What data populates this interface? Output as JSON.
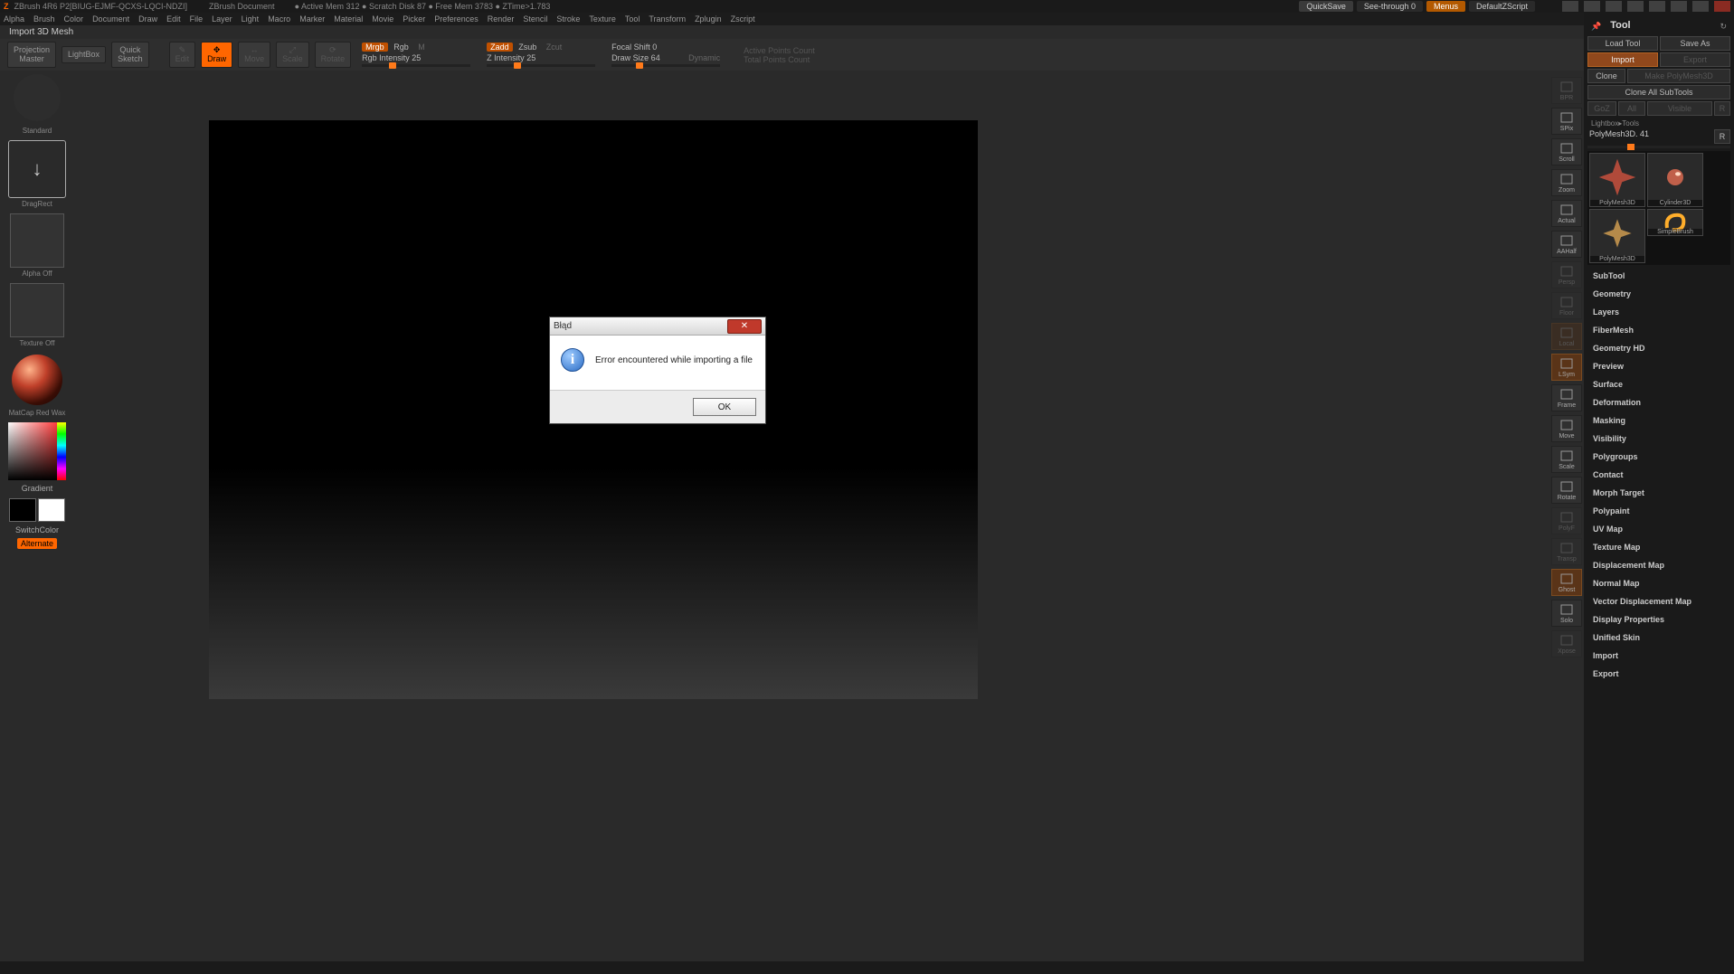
{
  "app": {
    "title": "ZBrush 4R6 P2[BIUG-EJMF-QCXS-LQCI-NDZI]",
    "document": "ZBrush Document",
    "stats": "● Active Mem 312 ● Scratch Disk 87 ● Free Mem 3783 ● ZTime>1.783"
  },
  "topright": {
    "quicksave": "QuickSave",
    "seethrough": "See-through  0",
    "menus": "Menus",
    "script": "DefaultZScript"
  },
  "menus": [
    "Alpha",
    "Brush",
    "Color",
    "Document",
    "Draw",
    "Edit",
    "File",
    "Layer",
    "Light",
    "Macro",
    "Marker",
    "Material",
    "Movie",
    "Picker",
    "Preferences",
    "Render",
    "Stencil",
    "Stroke",
    "Texture",
    "Tool",
    "Transform",
    "Zplugin",
    "Zscript"
  ],
  "second": "Import 3D Mesh",
  "toolrow": {
    "proj": "Projection\nMaster",
    "lightbox": "LightBox",
    "quicksketch": "Quick\nSketch",
    "modes": [
      "Edit",
      "Draw",
      "Move",
      "Scale",
      "Rotate"
    ],
    "rgb": {
      "mrgb": "Mrgb",
      "rgb": "Rgb",
      "m": "M",
      "intensity": "Rgb Intensity 25",
      "value": 25
    },
    "z": {
      "zadd": "Zadd",
      "zsub": "Zsub",
      "zcut": "Zcut",
      "intensity": "Z Intensity 25",
      "value": 25
    },
    "draw": {
      "focal": "Focal Shift 0",
      "size": "Draw Size 64",
      "dynamic": "Dynamic"
    },
    "points": {
      "active": "Active Points Count",
      "total": "Total Points Count"
    }
  },
  "leftshelf": {
    "brush": "Standard",
    "stroke": "DragRect",
    "alpha": "Alpha Off",
    "texture": "Texture Off",
    "material": "MatCap Red Wax",
    "gradient": "Gradient",
    "switch": "SwitchColor",
    "alternate": "Alternate"
  },
  "rail": [
    "BPR",
    "SPix",
    "Scroll",
    "Zoom",
    "Actual",
    "AAHalf",
    "Persp",
    "Floor",
    "Local",
    "LSym",
    "Frame",
    "Move",
    "Scale",
    "Rotate",
    "PolyF",
    "Transp",
    "Ghost",
    "Solo",
    "Xpose"
  ],
  "toolpanel": {
    "title": "Tool",
    "btns": {
      "load": "Load Tool",
      "saveas": "Save As",
      "import": "Import",
      "export": "Export",
      "clone": "Clone",
      "makepoly": "Make PolyMesh3D",
      "cloneall": "Clone All SubTools",
      "go2": "GoZ",
      "all": "All",
      "visible": "Visible",
      "r": "R"
    },
    "lightbox": "Lightbox▸Tools",
    "curtool": "PolyMesh3D. 41",
    "curtoolR": "R",
    "thumbs": [
      "PolyMesh3D",
      "Cylinder3D",
      "PolyMesh3D",
      "SimpleBrush"
    ],
    "sections": [
      "SubTool",
      "Geometry",
      "Layers",
      "FiberMesh",
      "Geometry HD",
      "Preview",
      "Surface",
      "Deformation",
      "Masking",
      "Visibility",
      "Polygroups",
      "Contact",
      "Morph Target",
      "Polypaint",
      "UV Map",
      "Texture Map",
      "Displacement Map",
      "Normal Map",
      "Vector Displacement Map",
      "Display Properties",
      "Unified Skin",
      "Import",
      "Export"
    ]
  },
  "dialog": {
    "title": "Błąd",
    "msg": "Error encountered while importing a file",
    "ok": "OK"
  }
}
